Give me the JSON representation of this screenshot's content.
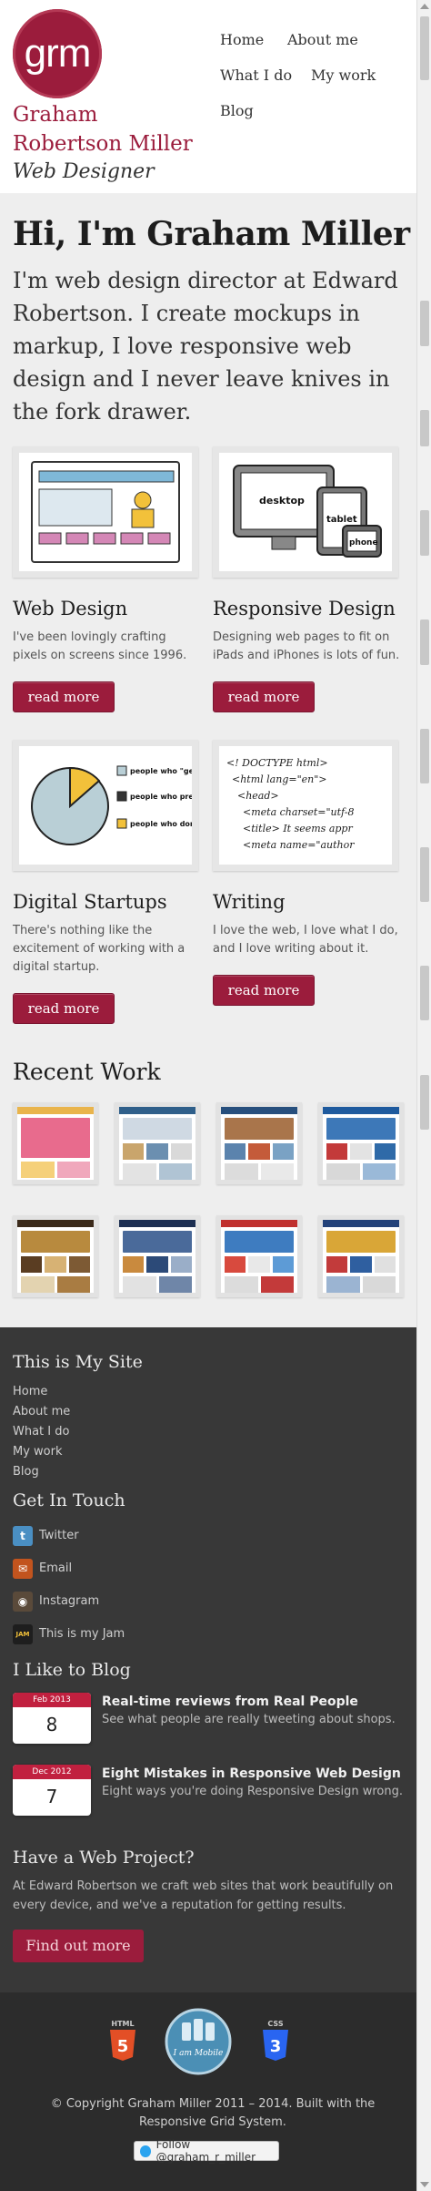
{
  "header": {
    "logo_text": "grm",
    "name": "Graham Robertson Miller",
    "role": "Web Designer",
    "nav": [
      "Home",
      "About me",
      "What I do",
      "My work",
      "Blog"
    ]
  },
  "intro": {
    "heading": "Hi, I'm Graham Miller",
    "text": "I'm web design director at Edward Robertson. I create mockups in markup, I love responsive web design and I never leave knives in the fork drawer."
  },
  "services": [
    {
      "title": "Web Design",
      "text": "I've been lovingly crafting pixels on screens since 1996.",
      "button": "read more"
    },
    {
      "title": "Responsive Design",
      "text": "Designing web pages to fit on iPads and iPhones is lots of fun.",
      "button": "read more"
    },
    {
      "title": "Digital Startups",
      "text": "There's nothing like the excitement of working with a digital startup.",
      "button": "read more"
    },
    {
      "title": "Writing",
      "text": "I love the web, I love what I do, and I love writing about it.",
      "button": "read more"
    }
  ],
  "illustrations": {
    "responsive": {
      "desktop": "desktop",
      "tablet": "tablet",
      "phone": "phone"
    },
    "pie": {
      "legend": [
        "people who \"get\" pie charts",
        "people who pretend to",
        "people who don't"
      ]
    },
    "code": [
      "<! DOCTYPE html>",
      "<html lang=\"en\">",
      "<head>",
      "<meta charset=\"utf-8",
      "<title> It seems appr",
      "<meta name=\"author"
    ]
  },
  "recent": {
    "title": "Recent Work"
  },
  "footer": {
    "site_title": "This is My Site",
    "site_links": [
      "Home",
      "About me",
      "What I do",
      "My work",
      "Blog"
    ],
    "touch_title": "Get In Touch",
    "social": [
      {
        "icon": "twitter-icon",
        "label": "Twitter",
        "color": "#4a8fc3",
        "glyph": "t"
      },
      {
        "icon": "email-icon",
        "label": "Email",
        "color": "#c2541e",
        "glyph": "✉"
      },
      {
        "icon": "instagram-icon",
        "label": "Instagram",
        "color": "#5a4a3a",
        "glyph": "◉"
      },
      {
        "icon": "jam-icon",
        "label": "This is my Jam",
        "color": "#1e1e1e",
        "glyph": "JAM"
      }
    ],
    "blog_title": "I Like to Blog",
    "posts": [
      {
        "month": "Feb 2013",
        "day": "8",
        "title": "Real-time reviews from Real People",
        "sub": "See what people are really tweeting about shops."
      },
      {
        "month": "Dec 2012",
        "day": "7",
        "title": "Eight Mistakes in Responsive Web Design",
        "sub": "Eight ways you're doing Responsive Design wrong."
      }
    ],
    "project_title": "Have a Web Project?",
    "project_text": "At Edward Robertson we craft web sites that work beautifully on every device, and we've a reputation for getting results.",
    "project_button": "Find out more",
    "badges": {
      "html5": "HTML",
      "mobile": "I am Mobile",
      "css3": "CSS"
    },
    "copyright": "© Copyright Graham Miller 2011 – 2014. Built with the Responsive Grid System.",
    "follow": "Follow @graham_r_miller"
  },
  "colors": {
    "accent": "#9b1c3c",
    "dark": "#383838"
  }
}
